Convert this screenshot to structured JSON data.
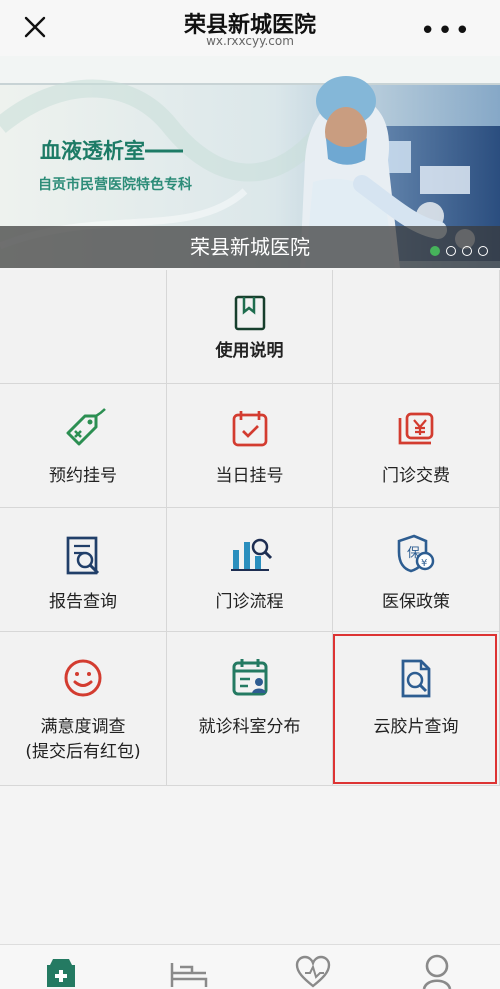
{
  "header": {
    "title": "荣县新城医院",
    "url": "wx.rxxcyy.com"
  },
  "banner": {
    "headline": "血液透析室",
    "subheadline": "自贡市民营医院特色专科",
    "caption": "荣县新城医院",
    "slide_count": 4,
    "active_slide": 1
  },
  "menu": {
    "instructions": "使用说明",
    "appointment": "预约挂号",
    "same_day": "当日挂号",
    "payment": "门诊交费",
    "report": "报告查询",
    "process": "门诊流程",
    "insurance": "医保政策",
    "survey_line1": "满意度调查",
    "survey_line2": "(提交后有红包)",
    "departments": "就诊科室分布",
    "film": "云胶片查询"
  },
  "icons": {
    "close": "close-icon",
    "more": "more-icon",
    "book": "book-icon",
    "tag": "tag-icon",
    "calendar": "calendar-check-icon",
    "money": "money-box-icon",
    "report": "report-search-icon",
    "process": "process-icon",
    "insurance": "insurance-shield-icon",
    "smile": "smile-icon",
    "department": "department-icon",
    "film": "film-search-icon",
    "home": "medical-home-icon",
    "bed": "bed-icon",
    "heart": "heart-icon",
    "user": "user-icon"
  },
  "colors": {
    "green": "#2f8f66",
    "blue": "#2d5d91",
    "red": "#d33c30",
    "highlight": "#d33333"
  }
}
